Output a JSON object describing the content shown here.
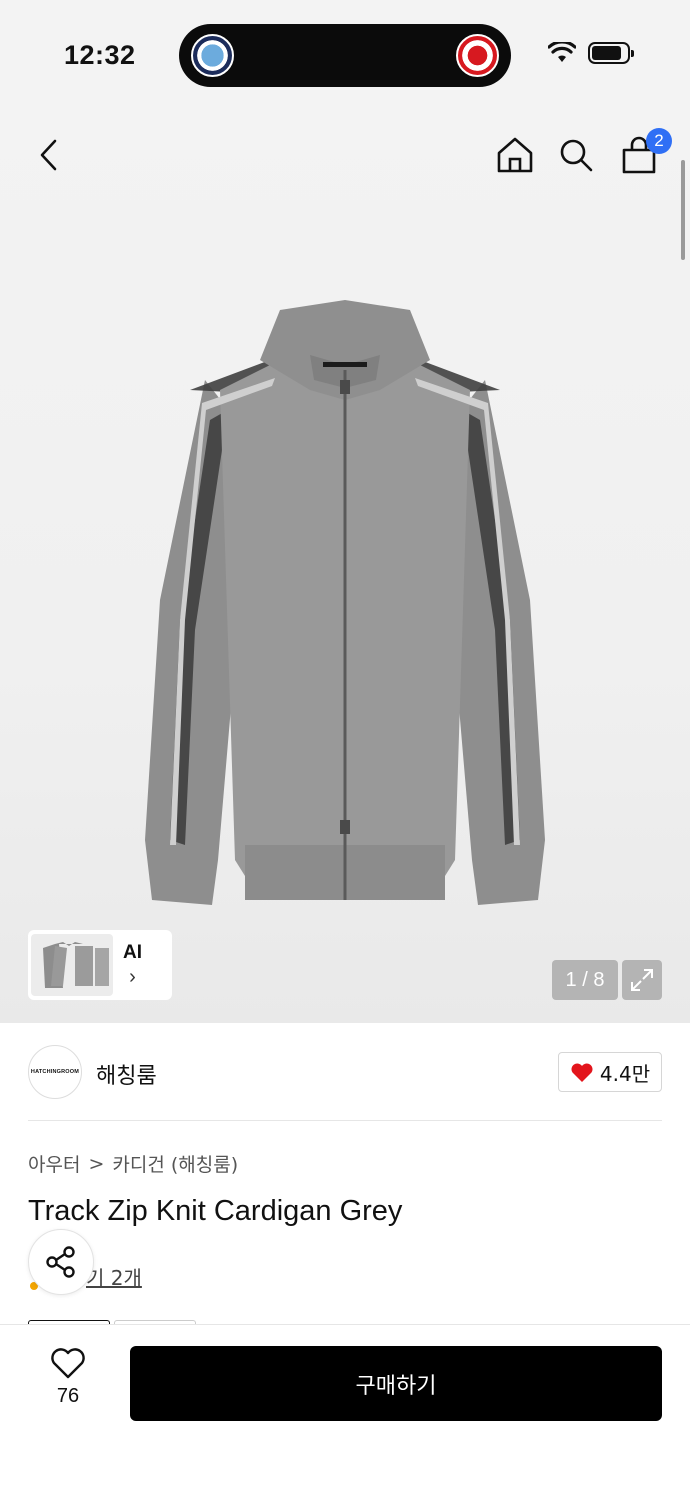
{
  "status_bar": {
    "time": "12:32",
    "battery_level": 0.85
  },
  "nav": {
    "cart_count": "2",
    "icons": [
      "back-icon",
      "home-icon",
      "search-icon",
      "cart-icon"
    ]
  },
  "gallery": {
    "ai_label": "AI",
    "pager": "1 / 8"
  },
  "brand": {
    "name": "해칭룸",
    "logo_text": "HATCHINGROOM",
    "likes": "4.4만"
  },
  "breadcrumb": {
    "category": "아우터",
    "separator": ">",
    "subcategory": "카디건 (해칭룸)"
  },
  "product": {
    "title": "Track Zip Knit Cardigan Grey",
    "review_text": "기 2개"
  },
  "bottom_bar": {
    "wish_count": "76",
    "buy_label": "구매하기"
  },
  "colors": {
    "accent": "#2f6ff5",
    "heart": "#e3151c",
    "primary": "#000000"
  }
}
